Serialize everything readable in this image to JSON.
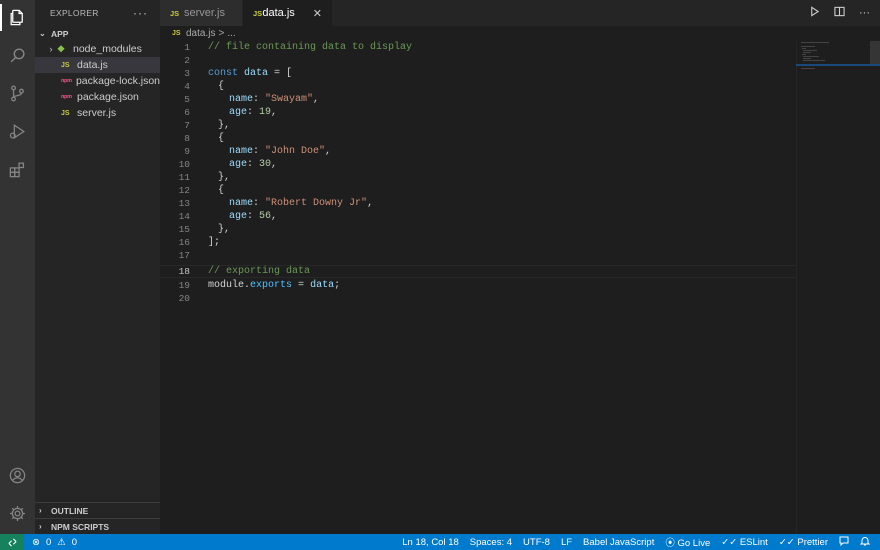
{
  "activity_bar": {
    "icons": [
      "files-icon",
      "search-icon",
      "source-control-icon",
      "run-debug-icon",
      "extensions-icon",
      "account-icon",
      "settings-gear-icon"
    ]
  },
  "sidebar": {
    "title": "EXPLORER",
    "more_actions": "···",
    "folder": "APP",
    "items": [
      {
        "label": "node_modules",
        "type": "folder",
        "icon": "node-folder-icon"
      },
      {
        "label": "data.js",
        "type": "js",
        "icon": "js-file-icon",
        "active": true
      },
      {
        "label": "package-lock.json",
        "type": "json",
        "icon": "npm-file-icon"
      },
      {
        "label": "package.json",
        "type": "json",
        "icon": "npm-file-icon"
      },
      {
        "label": "server.js",
        "type": "js",
        "icon": "js-file-icon"
      }
    ],
    "outline": "OUTLINE",
    "npm_scripts": "NPM SCRIPTS"
  },
  "tabs": [
    {
      "label": "server.js",
      "icon_text": "JS",
      "active": false
    },
    {
      "label": "data.js",
      "icon_text": "JS",
      "active": true,
      "close": "✕"
    }
  ],
  "file_icon_text": {
    "js": "JS",
    "json": "{ }",
    "npm": "npm"
  },
  "breadcrumb": {
    "file": "data.js",
    "separator": ">",
    "more": "..."
  },
  "editor": {
    "current_line": 18,
    "lines": [
      {
        "n": "1"
      },
      {
        "n": "2"
      },
      {
        "n": "3"
      },
      {
        "n": "4"
      },
      {
        "n": "5"
      },
      {
        "n": "6"
      },
      {
        "n": "7"
      },
      {
        "n": "8"
      },
      {
        "n": "9"
      },
      {
        "n": "10"
      },
      {
        "n": "11"
      },
      {
        "n": "12"
      },
      {
        "n": "13"
      },
      {
        "n": "14"
      },
      {
        "n": "15"
      },
      {
        "n": "16"
      },
      {
        "n": "17"
      },
      {
        "n": "18"
      },
      {
        "n": "19"
      },
      {
        "n": "20"
      }
    ],
    "code": {
      "comment1": "// file containing data to display",
      "const_kw": "const",
      "data_var": "data",
      "eq_bracket": " = [",
      "open_brace": "{",
      "close_brace": "},",
      "name_key": "name",
      "age_key": "age",
      "colon": ": ",
      "comma": ",",
      "name1": "\"Swayam\"",
      "age1": "19",
      "name2": "\"John Doe\"",
      "age2": "30",
      "name3": "\"Robert Downy Jr\"",
      "age3": "56",
      "close_array": "];",
      "comment2": "// exporting data",
      "module": "module",
      "dot": ".",
      "exports": "exports",
      "eq": " = ",
      "semi": ";"
    }
  },
  "statusbar": {
    "remote_icon": "remote-icon",
    "errors": "0",
    "warnings": "0",
    "position": "Ln 18, Col 18",
    "spaces": "Spaces: 4",
    "encoding": "UTF-8",
    "eol": "LF",
    "language": "Babel JavaScript",
    "go_live": "Go Live",
    "eslint": "ESLint",
    "prettier": "Prettier"
  },
  "colors": {
    "statusbar": "#007acc",
    "remote": "#16825d",
    "editor_bg": "#1e1e1e",
    "sidebar_bg": "#252526",
    "activity_bg": "#333333"
  }
}
